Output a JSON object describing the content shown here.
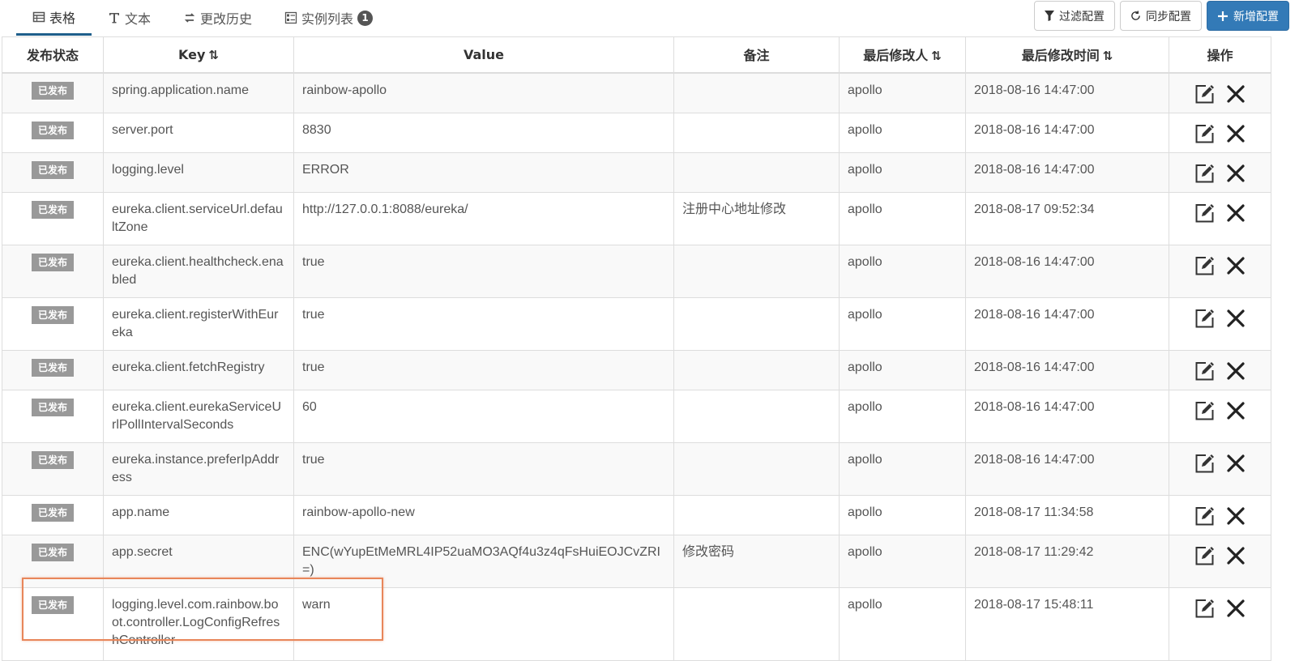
{
  "tabs": [
    {
      "label": "表格",
      "icon": "table-icon"
    },
    {
      "label": "文本",
      "icon": "text-icon"
    },
    {
      "label": "更改历史",
      "icon": "history-icon"
    },
    {
      "label": "实例列表",
      "icon": "instance-list-icon",
      "badge": "1"
    }
  ],
  "toolbar": {
    "filter_label": "过滤配置",
    "sync_label": "同步配置",
    "add_label": "新增配置"
  },
  "columns": {
    "status": "发布状态",
    "key": "Key",
    "value": "Value",
    "comment": "备注",
    "modifier": "最后修改人",
    "modified_time": "最后修改时间",
    "ops": "操作"
  },
  "rows": [
    {
      "status": "已发布",
      "key": "spring.application.name",
      "value": "rainbow-apollo",
      "comment": "",
      "modifier": "apollo",
      "time": "2018-08-16 14:47:00"
    },
    {
      "status": "已发布",
      "key": "server.port",
      "value": "8830",
      "comment": "",
      "modifier": "apollo",
      "time": "2018-08-16 14:47:00"
    },
    {
      "status": "已发布",
      "key": "logging.level",
      "value": "ERROR",
      "comment": "",
      "modifier": "apollo",
      "time": "2018-08-16 14:47:00"
    },
    {
      "status": "已发布",
      "key": "eureka.client.serviceUrl.defaultZone",
      "value": "http://127.0.0.1:8088/eureka/",
      "comment": "注册中心地址修改",
      "modifier": "apollo",
      "time": "2018-08-17 09:52:34"
    },
    {
      "status": "已发布",
      "key": "eureka.client.healthcheck.enabled",
      "value": "true",
      "comment": "",
      "modifier": "apollo",
      "time": "2018-08-16 14:47:00"
    },
    {
      "status": "已发布",
      "key": "eureka.client.registerWithEureka",
      "value": "true",
      "comment": "",
      "modifier": "apollo",
      "time": "2018-08-16 14:47:00"
    },
    {
      "status": "已发布",
      "key": "eureka.client.fetchRegistry",
      "value": "true",
      "comment": "",
      "modifier": "apollo",
      "time": "2018-08-16 14:47:00"
    },
    {
      "status": "已发布",
      "key": "eureka.client.eurekaServiceUrlPollIntervalSeconds",
      "value": "60",
      "comment": "",
      "modifier": "apollo",
      "time": "2018-08-16 14:47:00"
    },
    {
      "status": "已发布",
      "key": "eureka.instance.preferIpAddress",
      "value": "true",
      "comment": "",
      "modifier": "apollo",
      "time": "2018-08-16 14:47:00"
    },
    {
      "status": "已发布",
      "key": "app.name",
      "value": "rainbow-apollo-new",
      "comment": "",
      "modifier": "apollo",
      "time": "2018-08-17 11:34:58"
    },
    {
      "status": "已发布",
      "key": "app.secret",
      "value": "ENC(wYupEtMeMRL4IP52uaMO3AQf4u3z4qFsHuiEOJCvZRI=)",
      "comment": "修改密码",
      "modifier": "apollo",
      "time": "2018-08-17 11:29:42"
    },
    {
      "status": "已发布",
      "key": "logging.level.com.rainbow.boot.controller.LogConfigRefreshController",
      "value": "warn",
      "comment": "",
      "modifier": "apollo",
      "time": "2018-08-17 15:48:11"
    }
  ],
  "colors": {
    "accent": "#337ab7",
    "tab_underline": "#1f5f8b",
    "status_badge": "#999999",
    "highlight": "#e8865a"
  }
}
